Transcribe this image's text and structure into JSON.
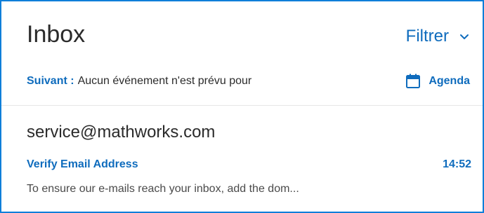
{
  "colors": {
    "accent": "#0f6cbd",
    "frame_border": "#0f7fd9",
    "text": "#2b2b2b"
  },
  "header": {
    "title": "Inbox",
    "filter_label": "Filtrer",
    "filter_icon": "chevron-down-icon"
  },
  "next_event": {
    "label": "Suivant :",
    "text": "Aucun événement n'est prévu pour",
    "agenda_label": "Agenda",
    "agenda_icon": "calendar-icon"
  },
  "messages": [
    {
      "sender": "service@mathworks.com",
      "subject": "Verify Email Address",
      "time": "14:52",
      "preview": "To ensure our e-mails reach your inbox, add the dom..."
    }
  ]
}
